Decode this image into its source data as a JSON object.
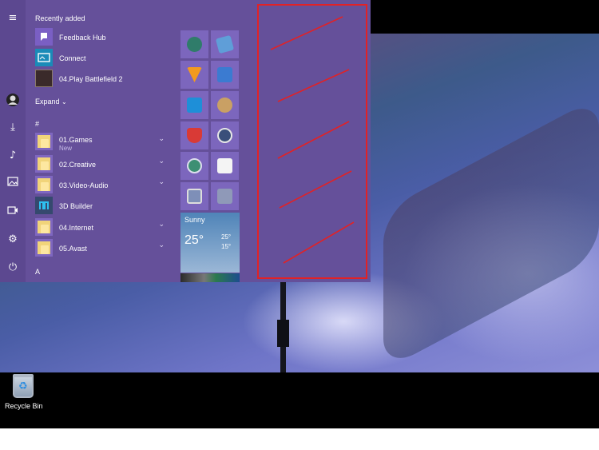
{
  "start_menu": {
    "rail_icons": [
      "hamburger-icon",
      "user-avatar-icon",
      "downloads-icon",
      "music-icon",
      "pictures-icon",
      "videos-icon",
      "settings-icon",
      "power-icon"
    ],
    "recently_added_header": "Recently added",
    "recent": [
      {
        "label": "Feedback Hub",
        "icon": "feedback-hub-icon"
      },
      {
        "label": "Connect",
        "icon": "connect-icon"
      },
      {
        "label": "04.Play Battlefield 2",
        "icon": "battlefield-icon"
      }
    ],
    "expand_label": "Expand",
    "hash_header": "#",
    "apps": [
      {
        "label": "01.Games",
        "sub": "New",
        "folder": true
      },
      {
        "label": "02.Creative",
        "sub": "",
        "folder": true
      },
      {
        "label": "03.Video-Audio",
        "sub": "",
        "folder": true
      },
      {
        "label": "3D Builder",
        "sub": "",
        "folder": false
      },
      {
        "label": "04.Internet",
        "sub": "",
        "folder": true
      },
      {
        "label": "05.Avast",
        "sub": "",
        "folder": true
      }
    ],
    "a_header": "A",
    "tiles": [
      {
        "icon": "photo-viewer-icon",
        "color": "#2f7c6a"
      },
      {
        "icon": "paint-tile-icon",
        "color": "#5f9ed8"
      },
      {
        "icon": "vlc-icon",
        "color": "#f29a1f"
      },
      {
        "icon": "ten-icon",
        "color": "#3b7bd1"
      },
      {
        "icon": "snip-icon",
        "color": "#1e8fd8"
      },
      {
        "icon": "palette-icon",
        "color": "#c9a064"
      },
      {
        "icon": "shield-icon",
        "color": "#d93a36"
      },
      {
        "icon": "globe-icon",
        "color": "#3a4f7a"
      },
      {
        "icon": "camera-lens-icon",
        "color": "#3d8f73"
      },
      {
        "icon": "camera-icon",
        "color": "#f4f4f4"
      },
      {
        "icon": "monitor-icon",
        "color": "#7e8fb8"
      },
      {
        "icon": "pen-tool-icon",
        "color": "#8f99b8"
      }
    ],
    "weather": {
      "condition": "Sunny",
      "current": "25°",
      "high": "25°",
      "low": "15°"
    }
  },
  "desktop": {
    "recycle_bin_label": "Recycle Bin"
  },
  "colors": {
    "menu": "#65509a",
    "rail": "#5c4890",
    "tile": "#7c66bd",
    "annotation": "#e12226"
  }
}
